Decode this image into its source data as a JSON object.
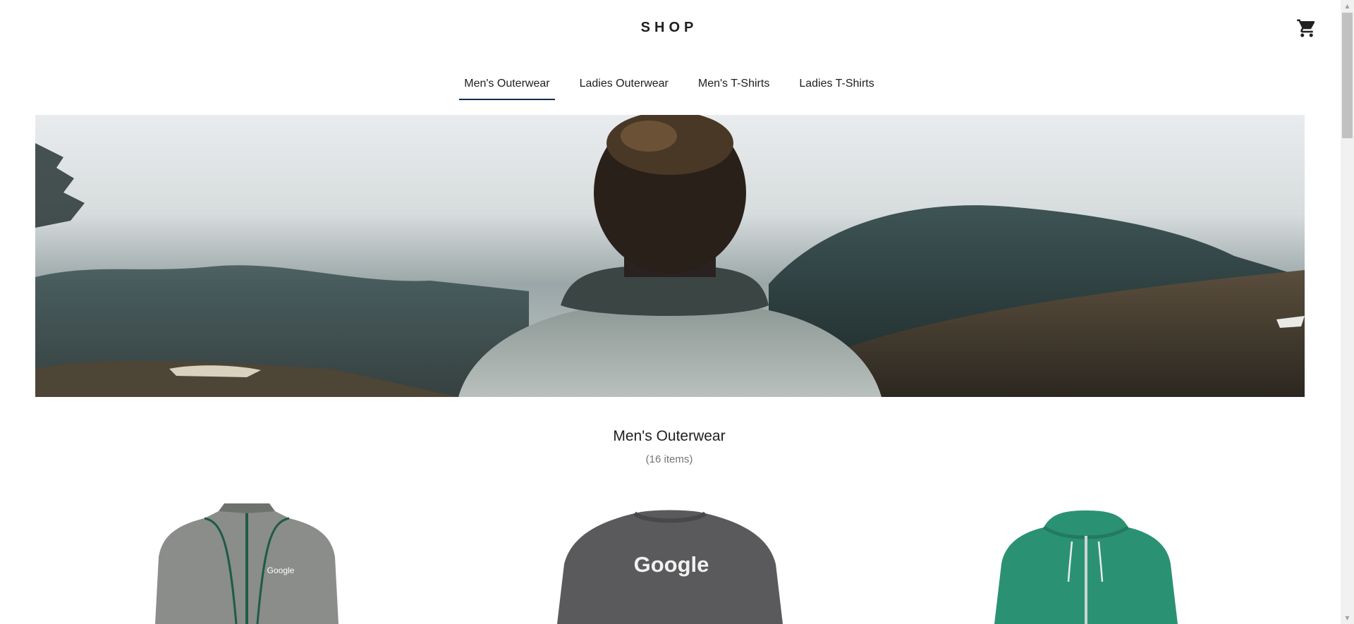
{
  "header": {
    "logo": "SHOP",
    "cart_icon": "shopping-cart-icon"
  },
  "tabs": [
    {
      "label": "Men's Outerwear",
      "active": true
    },
    {
      "label": "Ladies Outerwear",
      "active": false
    },
    {
      "label": "Men's T-Shirts",
      "active": false
    },
    {
      "label": "Ladies T-Shirts",
      "active": false
    }
  ],
  "hero": {
    "image": "man-in-gray-sweater-facing-misty-forest"
  },
  "category": {
    "title": "Men's Outerwear",
    "count": "(16 items)"
  },
  "products": [
    {
      "image": "gray-zip-jacket",
      "logo_text": "Google",
      "color": "#8a8d8a"
    },
    {
      "image": "dark-gray-sweatshirt",
      "logo_text": "Google",
      "color": "#5a5a5c"
    },
    {
      "image": "green-zip-hoodie",
      "logo_text": "",
      "color": "#2a9272"
    }
  ],
  "colors": {
    "active_tab_underline": "#172c50"
  }
}
